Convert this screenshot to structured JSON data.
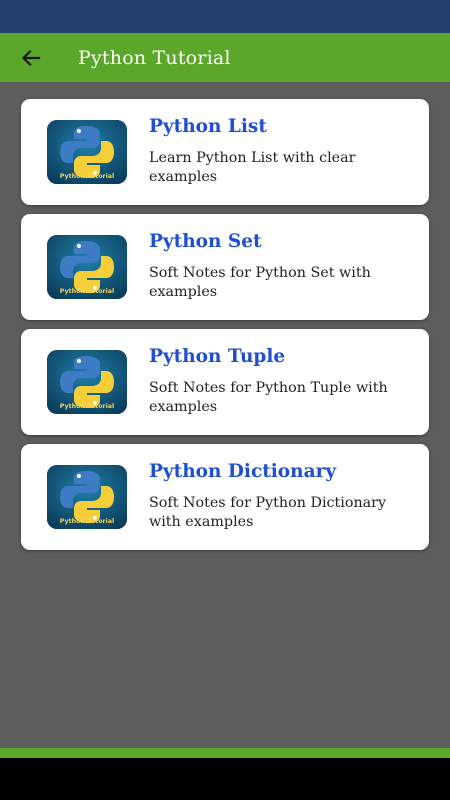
{
  "app_bar": {
    "title": "Python Tutorial",
    "back_icon": "arrow-left-icon",
    "color": "#5aa72a"
  },
  "status_bar": {
    "color": "#243f6c"
  },
  "cards": [
    {
      "title": "Python List",
      "description": "Learn Python List with clear examples",
      "thumb_caption": "Python Tutorial",
      "icon": "python-logo-icon"
    },
    {
      "title": "Python Set",
      "description": "Soft Notes for Python Set with examples",
      "thumb_caption": "Python Tutorial",
      "icon": "python-logo-icon"
    },
    {
      "title": "Python Tuple",
      "description": "Soft Notes for Python Tuple with examples",
      "thumb_caption": "Python Tutorial",
      "icon": "python-logo-icon"
    },
    {
      "title": "Python Dictionary",
      "description": "Soft Notes for Python Dictionary with examples",
      "thumb_caption": "Python Tutorial",
      "icon": "python-logo-icon"
    }
  ],
  "colors": {
    "card_title": "#1f4fd0",
    "background": "#5d5d5d"
  }
}
